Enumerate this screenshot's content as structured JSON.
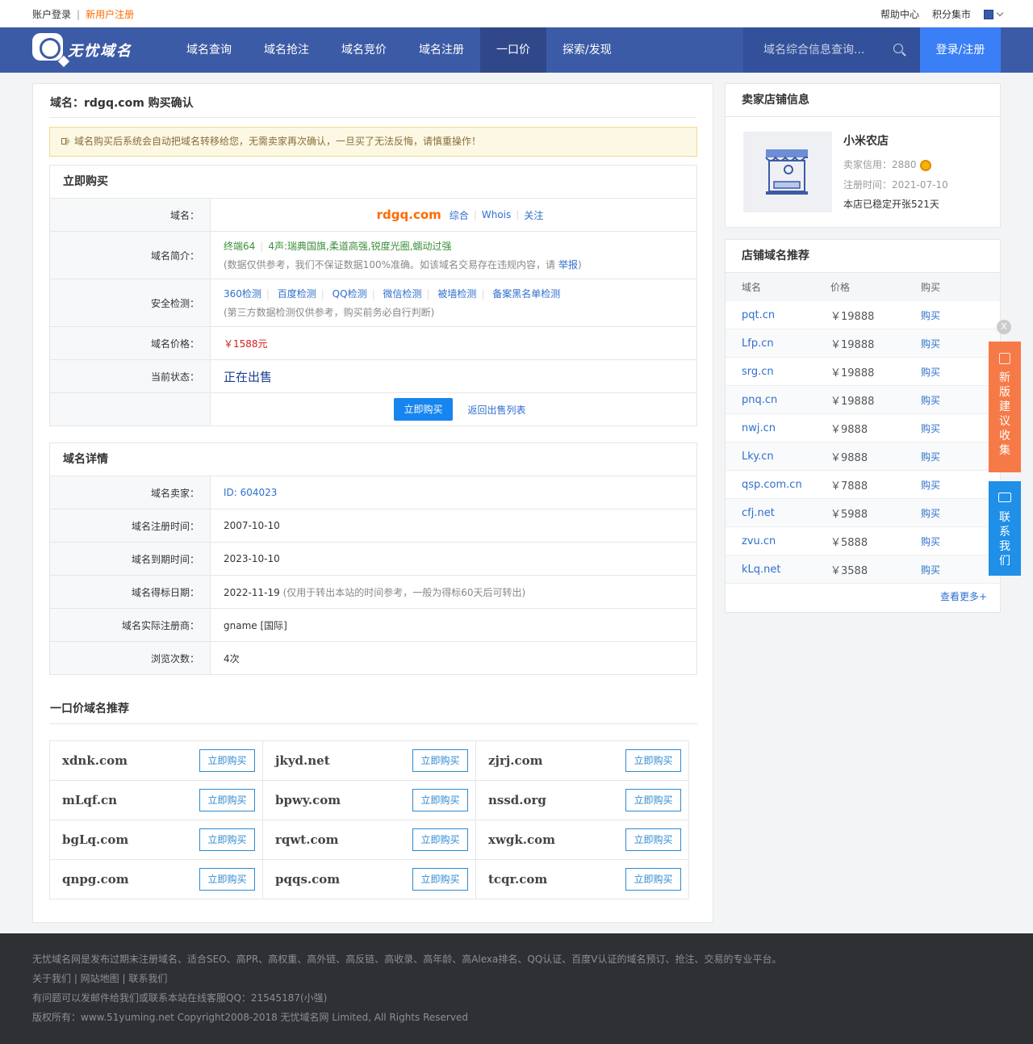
{
  "topbar": {
    "login": "账户登录",
    "sep": "|",
    "register": "新用户注册",
    "help": "帮助中心",
    "points": "积分集市"
  },
  "nav": {
    "logo_text": "无忧域名",
    "items": [
      "域名查询",
      "域名抢注",
      "域名竞价",
      "域名注册",
      "一口价",
      "探索/发现"
    ],
    "active": "一口价",
    "search_placeholder": "域名综合信息查询...",
    "login_register": "登录/注册"
  },
  "page": {
    "title": "域名：rdgq.com 购买确认",
    "notice": "域名购买后系统会自动把域名转移给您，无需卖家再次确认，一旦买了无法反悔，请慎重操作！"
  },
  "buy": {
    "header": "立即购买",
    "domain_label": "域名：",
    "domain": "rdgq.com",
    "domain_links": [
      "综合",
      "Whois",
      "关注"
    ],
    "intro_label": "域名简介：",
    "intro_text": "终端64",
    "intro_tags": "4声:瑞典国旗,柔道高强,锐度光圈,蠕动过强",
    "intro_disclaimer": "(数据仅供参考，我们不保证数据100%准确。如该域名交易存在违规内容，请",
    "report": "举报",
    "report_close": ")",
    "security_label": "安全检测：",
    "security_links": [
      "360检测",
      "百度检测",
      "QQ检测",
      "微信检测",
      "被墙检测",
      "备案黑名单检测"
    ],
    "security_note": "(第三方数据检测仅供参考，购买前务必自行判断)",
    "price_label": "域名价格：",
    "price": "￥1588元",
    "status_label": "当前状态：",
    "status": "正在出售",
    "buy_now": "立即购买",
    "back_list": "返回出售列表"
  },
  "detail": {
    "header": "域名详情",
    "rows": [
      {
        "label": "域名卖家：",
        "value": "ID: 604023",
        "note": ""
      },
      {
        "label": "域名注册时间：",
        "value": "2007-10-10",
        "note": ""
      },
      {
        "label": "域名到期时间：",
        "value": "2023-10-10",
        "note": ""
      },
      {
        "label": "域名得标日期：",
        "value": "2022-11-19",
        "note": "(仅用于转出本站的时间参考，一般为得标60天后可转出)"
      },
      {
        "label": "域名实际注册商：",
        "value": "gname [国际]",
        "note": ""
      },
      {
        "label": "浏览次数：",
        "value": "4次",
        "note": ""
      }
    ]
  },
  "recommend": {
    "title": "一口价域名推荐",
    "buy_label": "立即购买",
    "domains": [
      "xdnk.com",
      "jkyd.net",
      "zjrj.com",
      "mLqf.cn",
      "bpwy.com",
      "nssd.org",
      "bgLq.com",
      "rqwt.com",
      "xwgk.com",
      "qnpg.com",
      "pqqs.com",
      "tcqr.com"
    ]
  },
  "shop": {
    "header": "卖家店铺信息",
    "name": "小米农店",
    "credit": "卖家信用：2880",
    "reg_time": "注册时间：2021-07-10",
    "days": "本店已稳定开张521天"
  },
  "shop_domains": {
    "header": "店铺域名推荐",
    "columns": [
      "域名",
      "价格",
      "购买"
    ],
    "rows": [
      {
        "domain": "pqt.cn",
        "price": "￥19888",
        "action": "购买"
      },
      {
        "domain": "Lfp.cn",
        "price": "￥19888",
        "action": "购买"
      },
      {
        "domain": "srg.cn",
        "price": "￥19888",
        "action": "购买"
      },
      {
        "domain": "pnq.cn",
        "price": "￥19888",
        "action": "购买"
      },
      {
        "domain": "nwj.cn",
        "price": "￥9888",
        "action": "购买"
      },
      {
        "domain": "Lky.cn",
        "price": "￥9888",
        "action": "购买"
      },
      {
        "domain": "qsp.com.cn",
        "price": "￥7888",
        "action": "购买"
      },
      {
        "domain": "cfj.net",
        "price": "￥5988",
        "action": "购买"
      },
      {
        "domain": "zvu.cn",
        "price": "￥5888",
        "action": "购买"
      },
      {
        "domain": "kLq.net",
        "price": "￥3588",
        "action": "购买"
      }
    ],
    "more": "查看更多+"
  },
  "float": {
    "close": "X",
    "feedback": "新版建议收集",
    "contact": "联系我们"
  },
  "footer": {
    "line1": "无忧域名网是发布过期未注册域名、适合SEO、高PR、高权重、高外链、高反链、高收录、高年龄、高Alexa排名、QQ认证、百度V认证的域名预订、抢注、交易的专业平台。",
    "line2": "关于我们 | 网站地图 | 联系我们",
    "line3": "有问题可以发邮件给我们或联系本站在线客服QQ：21545187(小强)",
    "line4": "版权所有：www.51yuming.net Copyright2008-2018 无忧域名网 Limited, All Rights Reserved"
  }
}
